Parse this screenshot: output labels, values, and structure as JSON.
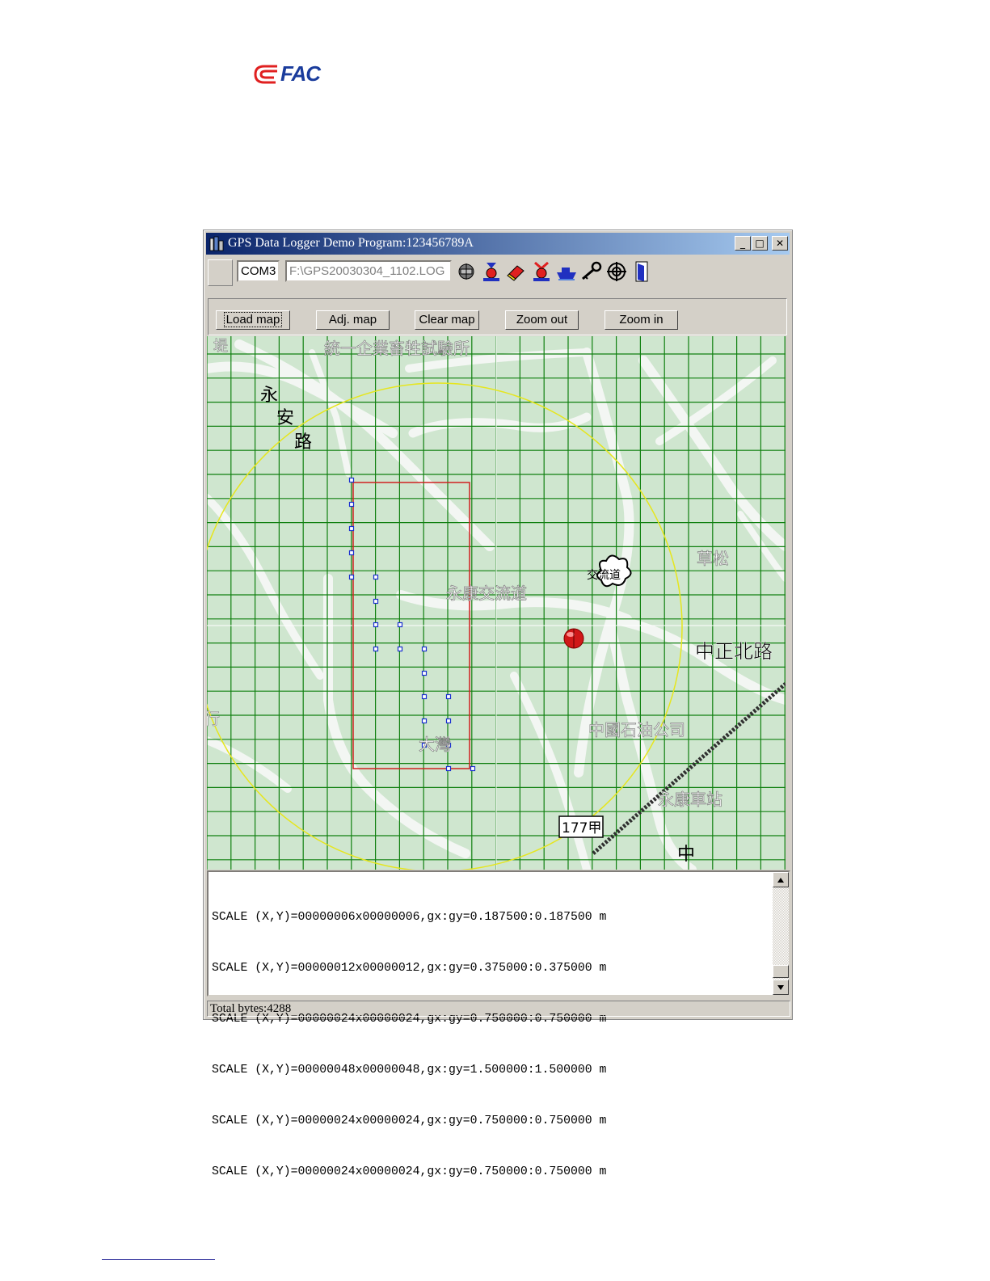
{
  "logo": {
    "text": "FAC",
    "brand_color": "#1a3c9c",
    "mark_color": "#e02020"
  },
  "window": {
    "title": "GPS Data Logger Demo Program:123456789A",
    "controls": {
      "minimize": "_",
      "maximize": "□",
      "close": "✕"
    }
  },
  "toolbar": {
    "port": "COM3",
    "file_path": "F:\\GPS20030304_1102.LOG",
    "icons": [
      "connect-icon",
      "record-icon",
      "erase-icon",
      "download-icon",
      "ship-icon",
      "key-icon",
      "target-icon",
      "exit-icon"
    ]
  },
  "buttons": {
    "load_map": "Load map",
    "adj_map": "Adj. map",
    "clear_map": "Clear map",
    "zoom_out": "Zoom out",
    "zoom_in": "Zoom in"
  },
  "map": {
    "labels": {
      "top_left": "堤",
      "top": "統一企業畜牲試驗所",
      "road1": "永",
      "road2": "安",
      "road3": "路",
      "pasture": "草松",
      "park": "永康交流道",
      "tw_road": "中正北路",
      "cpc": "中國石油公司",
      "village": "大灣",
      "station": "永康車站",
      "route": "177甲",
      "bottom": "中",
      "station_icon": "交流道",
      "left_edge": "行"
    },
    "colors": {
      "bg": "#cfe6cf",
      "road": "#f3f6f3",
      "grid": "#108010",
      "circle": "#e6e61e",
      "rect": "#d02020",
      "track": "#1a2fd0"
    }
  },
  "log": {
    "lines": [
      "SCALE (X,Y)=00000006x00000006,gx:gy=0.187500:0.187500 m",
      "SCALE (X,Y)=00000012x00000012,gx:gy=0.375000:0.375000 m",
      "SCALE (X,Y)=00000024x00000024,gx:gy=0.750000:0.750000 m",
      "SCALE (X,Y)=00000048x00000048,gx:gy=1.500000:1.500000 m",
      "SCALE (X,Y)=00000024x00000024,gx:gy=0.750000:0.750000 m",
      "SCALE (X,Y)=00000024x00000024,gx:gy=0.750000:0.750000 m"
    ]
  },
  "status": {
    "text": "Total bytes:4288"
  }
}
